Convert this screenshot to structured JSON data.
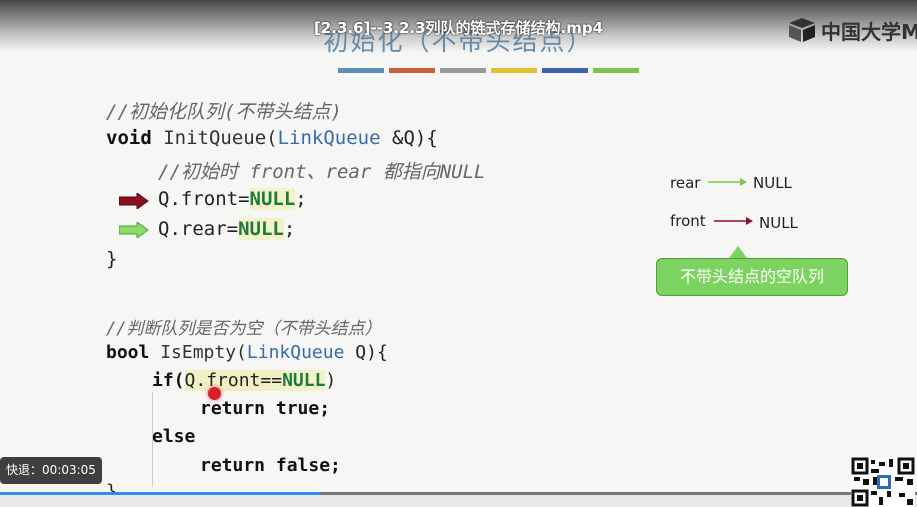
{
  "video": {
    "title": "[2.3.6]--3.2.3列队的链式存储结构.mp4",
    "rewind_label": "快退：00:03:05",
    "progress": 0.35
  },
  "slide": {
    "title": "初始化（不带头结点）",
    "color_bars": [
      "#5b8fb9",
      "#c9603a",
      "#9a9a9a",
      "#e2c22f",
      "#3d63a8",
      "#7cc54d"
    ]
  },
  "logo": {
    "text": "中国大学M"
  },
  "code": {
    "c1": "//初始化队列(不带头结点)",
    "l2a": "void",
    "l2b": " InitQueue(",
    "l2c": "LinkQueue",
    "l2d": " &Q){",
    "c3": "//初始时 front、rear 都指向NULL",
    "l4a": "Q.front=",
    "l4b": "NULL",
    "l4c": ";",
    "l5a": "Q.rear=",
    "l5b": "NULL",
    "l5c": ";",
    "l6": "}",
    "c7": "//判断队列是否为空（不带头结点）",
    "l8a": "bool",
    "l8b": " IsEmpty(",
    "l8c": "LinkQueue",
    "l8d": " Q){",
    "l9a": "if(",
    "l9b": "Q.front==",
    "l9c": "NULL",
    "l9d": ")",
    "l10a": "return",
    "l10b": " true;",
    "l11": "else",
    "l12a": "return",
    "l12b": " false;",
    "l13": "}"
  },
  "diagram": {
    "rear_label": "rear",
    "rear_null": "NULL",
    "front_label": "front",
    "front_null": "NULL",
    "bubble": "不带头结点的空队列",
    "rear_arrow_color": "#7cc54d",
    "front_arrow_color": "#8a0f2a"
  }
}
